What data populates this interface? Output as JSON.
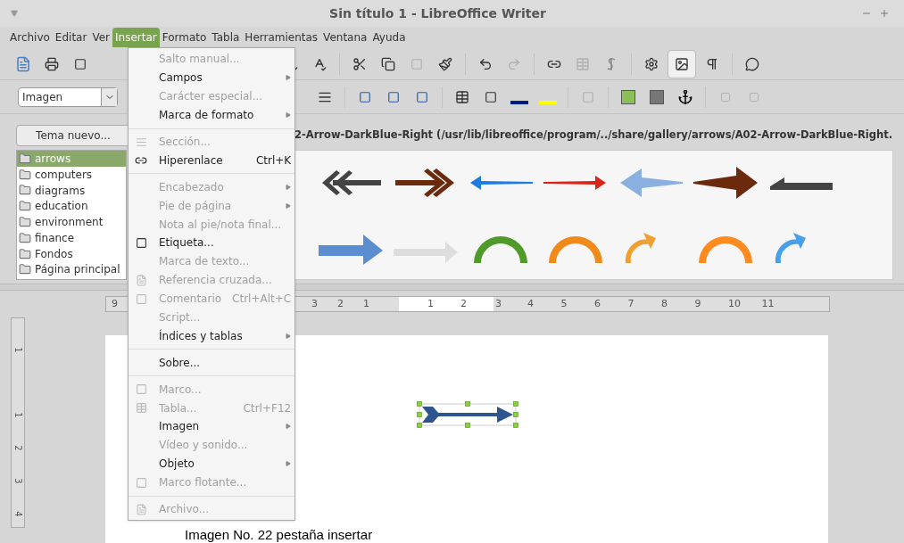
{
  "window": {
    "title": "Sin título 1 - LibreOffice Writer"
  },
  "menubar": [
    {
      "label": "Archivo",
      "selected": false
    },
    {
      "label": "Editar",
      "selected": false
    },
    {
      "label": "Ver",
      "selected": false
    },
    {
      "label": "Insertar",
      "selected": true
    },
    {
      "label": "Formato",
      "selected": false
    },
    {
      "label": "Tabla",
      "selected": false
    },
    {
      "label": "Herramientas",
      "selected": false
    },
    {
      "label": "Ventana",
      "selected": false
    },
    {
      "label": "Ayuda",
      "selected": false
    }
  ],
  "style_box": {
    "value": "Imagen"
  },
  "gallery": {
    "new_theme_button": "Tema nuevo...",
    "path": "2-Arrow-DarkBlue-Right (/usr/lib/libreoffice/program/../share/gallery/arrows/A02-Arrow-DarkBlue-Right.",
    "themes": [
      {
        "label": "arrows",
        "selected": true
      },
      {
        "label": "computers",
        "selected": false
      },
      {
        "label": "diagrams",
        "selected": false
      },
      {
        "label": "education",
        "selected": false
      },
      {
        "label": "environment",
        "selected": false
      },
      {
        "label": "finance",
        "selected": false
      },
      {
        "label": "Fondos",
        "selected": false
      },
      {
        "label": "Página principal",
        "selected": false
      }
    ]
  },
  "ruler": {
    "left_labels": [
      "9",
      "3",
      "2",
      "1"
    ],
    "right_labels": [
      "1",
      "2",
      "3",
      "4",
      "5",
      "6",
      "7",
      "8",
      "9",
      "10",
      "11"
    ],
    "vertical_labels": [
      "1",
      "1",
      "2",
      "3",
      "4"
    ]
  },
  "insert_menu": [
    {
      "kind": "item",
      "label": "Salto manual...",
      "enabled": false,
      "submenu": false
    },
    {
      "kind": "item",
      "label": "Campos",
      "enabled": true,
      "submenu": true
    },
    {
      "kind": "item",
      "label": "Carácter especial...",
      "enabled": false,
      "submenu": false
    },
    {
      "kind": "item",
      "label": "Marca de formato",
      "enabled": true,
      "submenu": true
    },
    {
      "kind": "separator"
    },
    {
      "kind": "item",
      "label": "Sección...",
      "enabled": false,
      "submenu": false
    },
    {
      "kind": "item",
      "label": "Hiperenlace",
      "enabled": true,
      "submenu": false,
      "shortcut": "Ctrl+K"
    },
    {
      "kind": "separator"
    },
    {
      "kind": "item",
      "label": "Encabezado",
      "enabled": false,
      "submenu": true
    },
    {
      "kind": "item",
      "label": "Pie de página",
      "enabled": false,
      "submenu": true
    },
    {
      "kind": "item",
      "label": "Nota al pie/nota final...",
      "enabled": false,
      "submenu": false
    },
    {
      "kind": "item",
      "label": "Etiqueta...",
      "enabled": true,
      "submenu": false
    },
    {
      "kind": "item",
      "label": "Marca de texto...",
      "enabled": false,
      "submenu": false
    },
    {
      "kind": "item",
      "label": "Referencia cruzada...",
      "enabled": false,
      "submenu": false
    },
    {
      "kind": "item",
      "label": "Comentario",
      "enabled": false,
      "submenu": false,
      "shortcut": "Ctrl+Alt+C"
    },
    {
      "kind": "item",
      "label": "Script...",
      "enabled": false,
      "submenu": false
    },
    {
      "kind": "item",
      "label": "Índices y tablas",
      "enabled": true,
      "submenu": true
    },
    {
      "kind": "separator"
    },
    {
      "kind": "item",
      "label": "Sobre...",
      "enabled": true,
      "submenu": false
    },
    {
      "kind": "separator"
    },
    {
      "kind": "item",
      "label": "Marco...",
      "enabled": false,
      "submenu": false
    },
    {
      "kind": "item",
      "label": "Tabla...",
      "enabled": false,
      "submenu": false,
      "shortcut": "Ctrl+F12"
    },
    {
      "kind": "item",
      "label": "Imagen",
      "enabled": true,
      "submenu": true
    },
    {
      "kind": "item",
      "label": "Vídeo y sonido...",
      "enabled": false,
      "submenu": false
    },
    {
      "kind": "item",
      "label": "Objeto",
      "enabled": true,
      "submenu": true
    },
    {
      "kind": "item",
      "label": "Marco flotante...",
      "enabled": false,
      "submenu": false
    },
    {
      "kind": "separator"
    },
    {
      "kind": "item",
      "label": "Archivo...",
      "enabled": false,
      "submenu": false
    }
  ],
  "caption": "Imagen No. 22 pestaña insertar"
}
